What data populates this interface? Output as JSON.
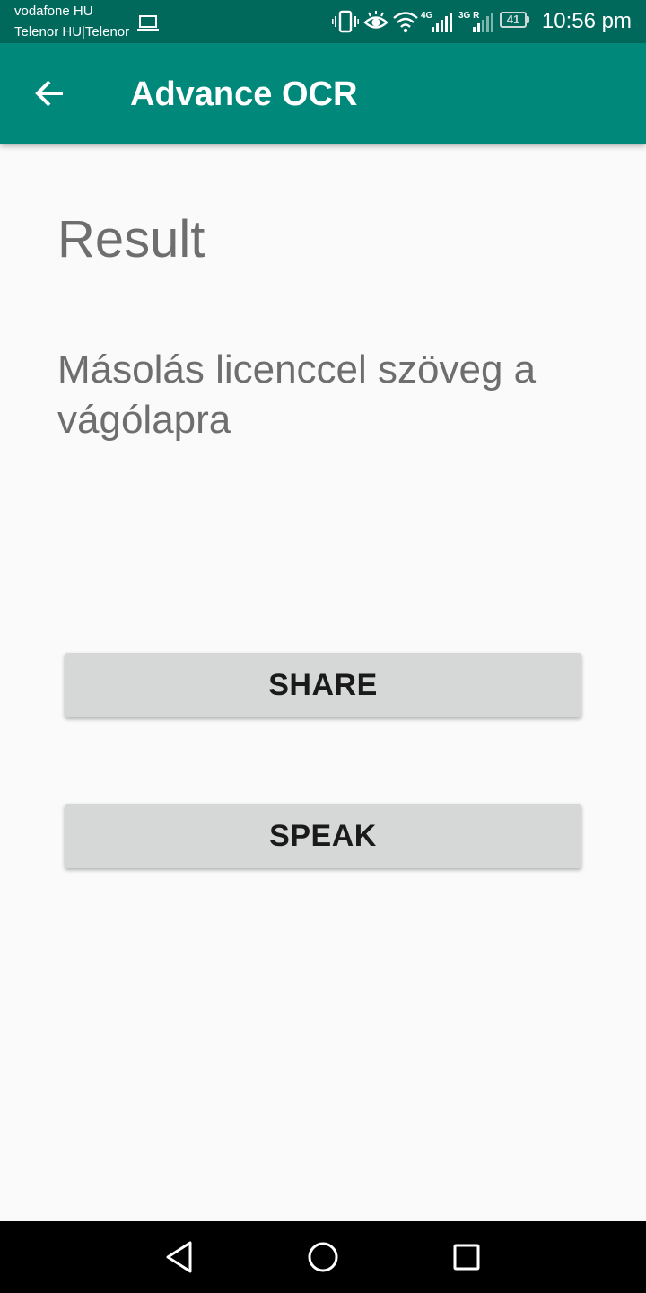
{
  "status_bar": {
    "carrier_1": "vodafone HU",
    "carrier_2": "Telenor HU|Telenor",
    "network_1": "4G",
    "network_2": "3G R",
    "battery_level": "41",
    "time": "10:56 pm",
    "icons": [
      "laptop-icon",
      "vibrate-icon",
      "eye-icon",
      "wifi-icon",
      "signal-icon",
      "signal-roaming-icon",
      "battery-icon"
    ]
  },
  "app_bar": {
    "title": "Advance OCR",
    "back_icon": "arrow-left-icon"
  },
  "content": {
    "heading": "Result",
    "recognized_text": "Másolás licenccel szöveg a vágólapra"
  },
  "buttons": {
    "share_label": "SHARE",
    "speak_label": "SPEAK"
  },
  "nav_bar": {
    "icons": [
      "back-triangle-icon",
      "home-circle-icon",
      "recents-square-icon"
    ]
  },
  "colors": {
    "status_bar": "#00695c",
    "app_bar": "#00897b",
    "background": "#fafafa",
    "button": "#d6d7d7",
    "text_gray": "#6e6e6e"
  }
}
